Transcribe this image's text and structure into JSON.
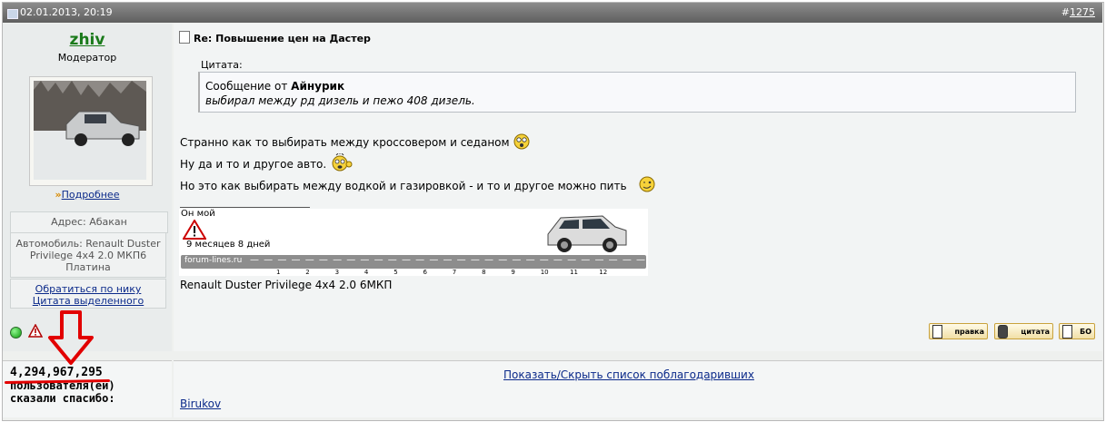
{
  "post": {
    "date": "02.01.2013, 20:19",
    "number_prefix": "#",
    "number": "1275",
    "title": "Re: Повышение цен на Дастер"
  },
  "user": {
    "name": "zhiv",
    "role": "Модератор",
    "more_link": "Подробнее",
    "address": "Адрес: Абакан",
    "car": "Автомобиль: Renault Duster Privilege 4x4 2.0 МКП6 Платина",
    "link_nick": "Обратиться по нику",
    "link_quote": "Цитата выделенного"
  },
  "quote": {
    "label": "Цитата:",
    "from_prefix": "Сообщение от",
    "author": "Айнурик",
    "text": "выбирал между рд дизель и пежо 408 дизель."
  },
  "body": {
    "line1": "Странно как то выбирать между кроссовером и седаном",
    "line2": "Ну да и то и другое авто.",
    "line3": "Но это как выбирать между водкой и газировкой - и то и другое можно пить"
  },
  "signature": {
    "banner_title": "Он мой",
    "banner_period": "9 месяцев 8 дней",
    "banner_site": "forum-lines.ru",
    "banner_ticks": [
      "1",
      "2",
      "3",
      "4",
      "5",
      "6",
      "7",
      "8",
      "9",
      "10",
      "11",
      "12"
    ],
    "car_text": "Renault Duster Privilege 4x4 2.0 6МКП"
  },
  "buttons": {
    "edit": "правка",
    "quote": "цитата",
    "bo": "БО"
  },
  "thanks": {
    "count": "4,294,967,295",
    "line2": "пользователя(ей)",
    "line3": "сказали спасибо:",
    "toggle": "Показать/Скрыть список поблагодаривших",
    "users": [
      "Birukov"
    ]
  },
  "colors": {
    "header": "#6e6e6e",
    "username": "#1a7a1a",
    "link": "#0b2a8a",
    "annotation": "#e20000"
  }
}
